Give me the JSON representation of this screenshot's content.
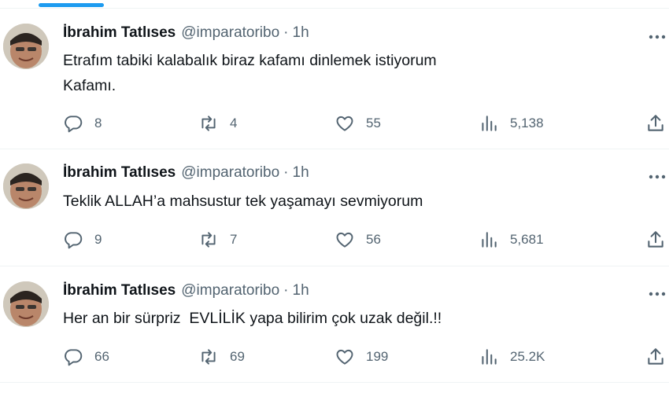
{
  "tweets": [
    {
      "name": "İbrahim Tatlıses",
      "handle": "@imparatoribo",
      "separator": "·",
      "time": "1h",
      "text": "Etrafım tabiki kalabalık biraz kafamı dinlemek istiyorum\nKafamı.",
      "replies": "8",
      "retweets": "4",
      "likes": "55",
      "views": "5,138"
    },
    {
      "name": "İbrahim Tatlıses",
      "handle": "@imparatoribo",
      "separator": "·",
      "time": "1h",
      "text": "Teklik ALLAH’a mahsustur tek yaşamayı sevmiyorum",
      "replies": "9",
      "retweets": "7",
      "likes": "56",
      "views": "5,681"
    },
    {
      "name": "İbrahim Tatlıses",
      "handle": "@imparatoribo",
      "separator": "·",
      "time": "1h",
      "text": "Her an bir sürpriz  EVLİLİK yapa bilirim çok uzak değil.!!",
      "replies": "66",
      "retweets": "69",
      "likes": "199",
      "views": "25.2K"
    }
  ],
  "icons": {
    "reply": "reply-icon",
    "retweet": "retweet-icon",
    "like": "like-icon",
    "views": "views-icon",
    "share": "share-icon",
    "more": "more-icon"
  },
  "colors": {
    "accent": "#1d9bf0",
    "secondary_text": "#536471",
    "primary_text": "#0f1419",
    "divider": "#eff3f4"
  }
}
